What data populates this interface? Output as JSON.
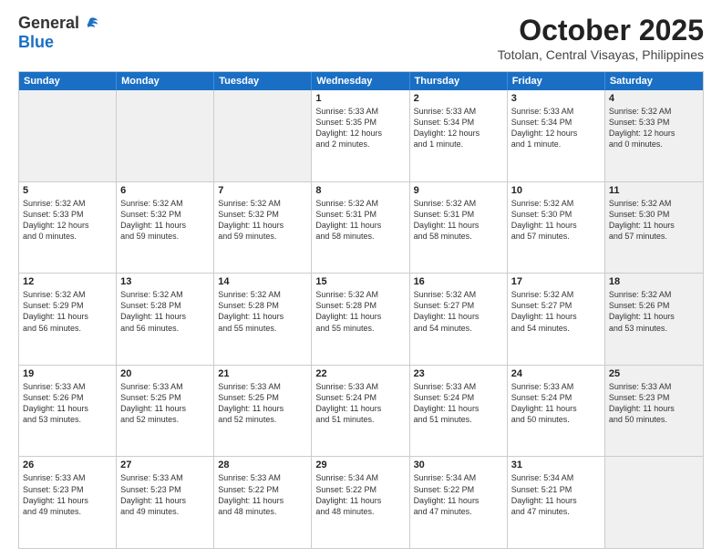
{
  "header": {
    "logo_line1": "General",
    "logo_line2": "Blue",
    "month": "October 2025",
    "location": "Totolan, Central Visayas, Philippines"
  },
  "days_of_week": [
    "Sunday",
    "Monday",
    "Tuesday",
    "Wednesday",
    "Thursday",
    "Friday",
    "Saturday"
  ],
  "weeks": [
    [
      {
        "day": "",
        "text": "",
        "shaded": true
      },
      {
        "day": "",
        "text": "",
        "shaded": true
      },
      {
        "day": "",
        "text": "",
        "shaded": true
      },
      {
        "day": "1",
        "text": "Sunrise: 5:33 AM\nSunset: 5:35 PM\nDaylight: 12 hours\nand 2 minutes.",
        "shaded": false
      },
      {
        "day": "2",
        "text": "Sunrise: 5:33 AM\nSunset: 5:34 PM\nDaylight: 12 hours\nand 1 minute.",
        "shaded": false
      },
      {
        "day": "3",
        "text": "Sunrise: 5:33 AM\nSunset: 5:34 PM\nDaylight: 12 hours\nand 1 minute.",
        "shaded": false
      },
      {
        "day": "4",
        "text": "Sunrise: 5:32 AM\nSunset: 5:33 PM\nDaylight: 12 hours\nand 0 minutes.",
        "shaded": true
      }
    ],
    [
      {
        "day": "5",
        "text": "Sunrise: 5:32 AM\nSunset: 5:33 PM\nDaylight: 12 hours\nand 0 minutes.",
        "shaded": false
      },
      {
        "day": "6",
        "text": "Sunrise: 5:32 AM\nSunset: 5:32 PM\nDaylight: 11 hours\nand 59 minutes.",
        "shaded": false
      },
      {
        "day": "7",
        "text": "Sunrise: 5:32 AM\nSunset: 5:32 PM\nDaylight: 11 hours\nand 59 minutes.",
        "shaded": false
      },
      {
        "day": "8",
        "text": "Sunrise: 5:32 AM\nSunset: 5:31 PM\nDaylight: 11 hours\nand 58 minutes.",
        "shaded": false
      },
      {
        "day": "9",
        "text": "Sunrise: 5:32 AM\nSunset: 5:31 PM\nDaylight: 11 hours\nand 58 minutes.",
        "shaded": false
      },
      {
        "day": "10",
        "text": "Sunrise: 5:32 AM\nSunset: 5:30 PM\nDaylight: 11 hours\nand 57 minutes.",
        "shaded": false
      },
      {
        "day": "11",
        "text": "Sunrise: 5:32 AM\nSunset: 5:30 PM\nDaylight: 11 hours\nand 57 minutes.",
        "shaded": true
      }
    ],
    [
      {
        "day": "12",
        "text": "Sunrise: 5:32 AM\nSunset: 5:29 PM\nDaylight: 11 hours\nand 56 minutes.",
        "shaded": false
      },
      {
        "day": "13",
        "text": "Sunrise: 5:32 AM\nSunset: 5:28 PM\nDaylight: 11 hours\nand 56 minutes.",
        "shaded": false
      },
      {
        "day": "14",
        "text": "Sunrise: 5:32 AM\nSunset: 5:28 PM\nDaylight: 11 hours\nand 55 minutes.",
        "shaded": false
      },
      {
        "day": "15",
        "text": "Sunrise: 5:32 AM\nSunset: 5:28 PM\nDaylight: 11 hours\nand 55 minutes.",
        "shaded": false
      },
      {
        "day": "16",
        "text": "Sunrise: 5:32 AM\nSunset: 5:27 PM\nDaylight: 11 hours\nand 54 minutes.",
        "shaded": false
      },
      {
        "day": "17",
        "text": "Sunrise: 5:32 AM\nSunset: 5:27 PM\nDaylight: 11 hours\nand 54 minutes.",
        "shaded": false
      },
      {
        "day": "18",
        "text": "Sunrise: 5:32 AM\nSunset: 5:26 PM\nDaylight: 11 hours\nand 53 minutes.",
        "shaded": true
      }
    ],
    [
      {
        "day": "19",
        "text": "Sunrise: 5:33 AM\nSunset: 5:26 PM\nDaylight: 11 hours\nand 53 minutes.",
        "shaded": false
      },
      {
        "day": "20",
        "text": "Sunrise: 5:33 AM\nSunset: 5:25 PM\nDaylight: 11 hours\nand 52 minutes.",
        "shaded": false
      },
      {
        "day": "21",
        "text": "Sunrise: 5:33 AM\nSunset: 5:25 PM\nDaylight: 11 hours\nand 52 minutes.",
        "shaded": false
      },
      {
        "day": "22",
        "text": "Sunrise: 5:33 AM\nSunset: 5:24 PM\nDaylight: 11 hours\nand 51 minutes.",
        "shaded": false
      },
      {
        "day": "23",
        "text": "Sunrise: 5:33 AM\nSunset: 5:24 PM\nDaylight: 11 hours\nand 51 minutes.",
        "shaded": false
      },
      {
        "day": "24",
        "text": "Sunrise: 5:33 AM\nSunset: 5:24 PM\nDaylight: 11 hours\nand 50 minutes.",
        "shaded": false
      },
      {
        "day": "25",
        "text": "Sunrise: 5:33 AM\nSunset: 5:23 PM\nDaylight: 11 hours\nand 50 minutes.",
        "shaded": true
      }
    ],
    [
      {
        "day": "26",
        "text": "Sunrise: 5:33 AM\nSunset: 5:23 PM\nDaylight: 11 hours\nand 49 minutes.",
        "shaded": false
      },
      {
        "day": "27",
        "text": "Sunrise: 5:33 AM\nSunset: 5:23 PM\nDaylight: 11 hours\nand 49 minutes.",
        "shaded": false
      },
      {
        "day": "28",
        "text": "Sunrise: 5:33 AM\nSunset: 5:22 PM\nDaylight: 11 hours\nand 48 minutes.",
        "shaded": false
      },
      {
        "day": "29",
        "text": "Sunrise: 5:34 AM\nSunset: 5:22 PM\nDaylight: 11 hours\nand 48 minutes.",
        "shaded": false
      },
      {
        "day": "30",
        "text": "Sunrise: 5:34 AM\nSunset: 5:22 PM\nDaylight: 11 hours\nand 47 minutes.",
        "shaded": false
      },
      {
        "day": "31",
        "text": "Sunrise: 5:34 AM\nSunset: 5:21 PM\nDaylight: 11 hours\nand 47 minutes.",
        "shaded": false
      },
      {
        "day": "",
        "text": "",
        "shaded": true
      }
    ]
  ]
}
